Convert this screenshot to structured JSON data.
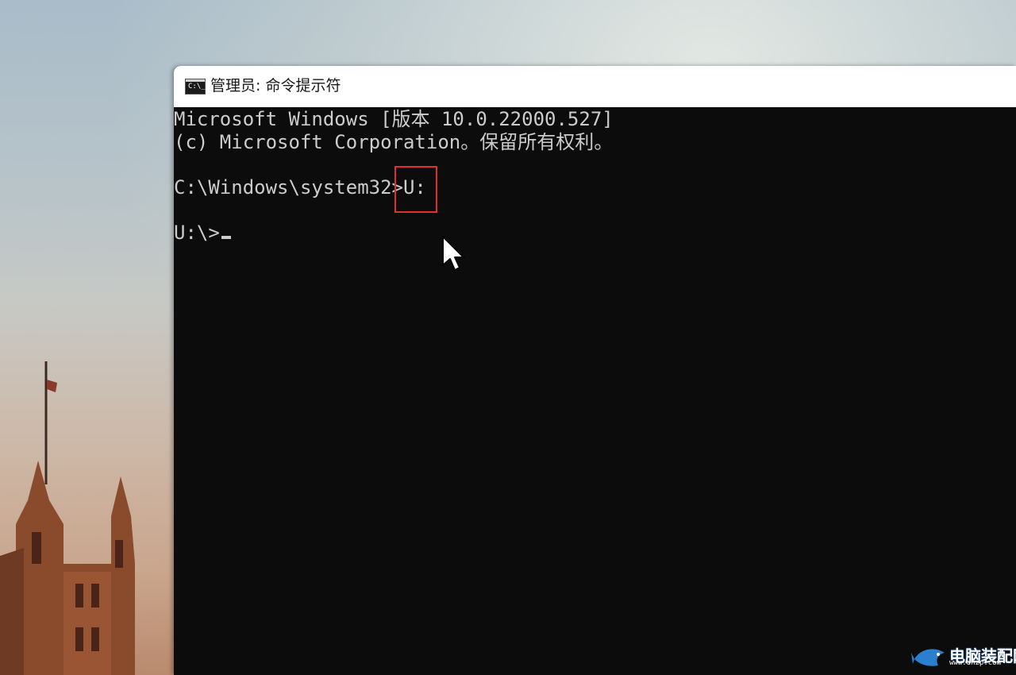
{
  "window": {
    "title": "管理员: 命令提示符",
    "icon": "cmd-icon",
    "icon_glyph": "C:\\_"
  },
  "console": {
    "lines": [
      "Microsoft Windows [版本 10.0.22000.527]",
      "(c) Microsoft Corporation。保留所有权利。",
      "",
      "C:\\Windows\\system32>U:",
      "",
      "U:\\>"
    ]
  },
  "annotation": {
    "highlight_color": "#e0302b"
  },
  "watermark": {
    "icon": "fish-logo-icon",
    "text": "电脑装配网",
    "sub": "www.dnzp.com"
  },
  "colors": {
    "console_bg": "#0c0c0c",
    "console_fg": "#cccccc",
    "titlebar_bg": "#ffffff"
  }
}
